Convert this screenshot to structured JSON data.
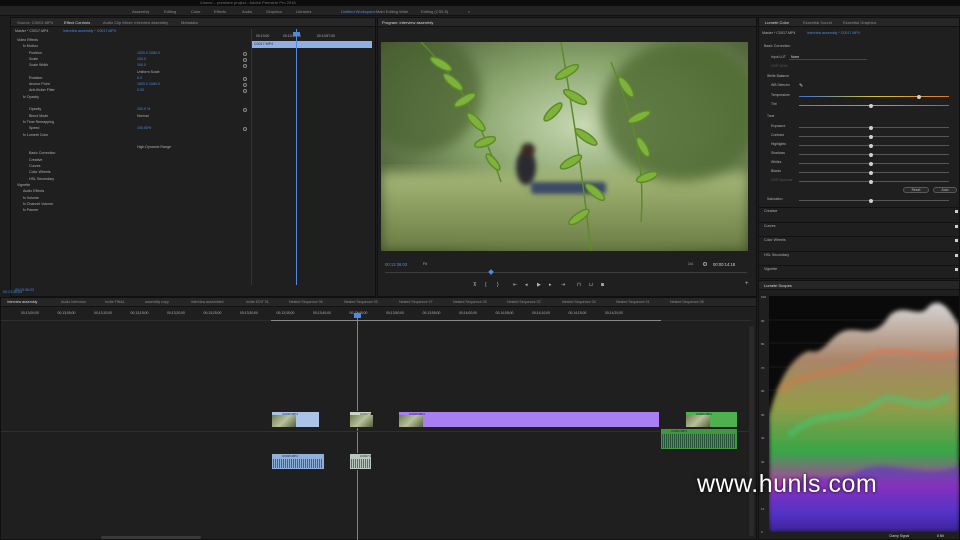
{
  "titlebar": {
    "text": "/Users/... premiere project - Adobe Premiere Pro 2018"
  },
  "workspaces": [
    {
      "label": "Assembly",
      "active": false
    },
    {
      "label": "Editing",
      "active": false
    },
    {
      "label": "Color",
      "active": false
    },
    {
      "label": "Effects",
      "active": false
    },
    {
      "label": "Audio",
      "active": false
    },
    {
      "label": "Graphics",
      "active": false
    },
    {
      "label": "Libraries",
      "active": false
    },
    {
      "label": "Untitled Workspace",
      "active": true
    },
    {
      "label": "Main Editing Wide",
      "active": false
    },
    {
      "label": "Editing (CS5.5)",
      "active": false
    }
  ],
  "effect_controls": {
    "tabs": [
      "Source: C0001.MP4",
      "Effect Controls",
      "Audio Clip Mixer: interview assembly",
      "Metadata"
    ],
    "selected_tab": 1,
    "header_clip": "Master * C0017.MP4",
    "header_seq": "interview assembly * C0017.MP4",
    "rows": [
      {
        "label": "Video Effects",
        "value": ""
      },
      {
        "label": "fx  Motion",
        "value": ""
      },
      {
        "label": "Position",
        "value": "1920.0   1080.0"
      },
      {
        "label": "Scale",
        "value": "100.0"
      },
      {
        "label": "Scale Width",
        "value": "100.0"
      },
      {
        "label": "",
        "value": "Uniform Scale"
      },
      {
        "label": "Rotation",
        "value": "0.0"
      },
      {
        "label": "Anchor Point",
        "value": "1920.0   1080.0"
      },
      {
        "label": "Anti-flicker Filter",
        "value": "0.00"
      },
      {
        "label": "fx  Opacity",
        "value": ""
      },
      {
        "label": "",
        "value": ""
      },
      {
        "label": "Opacity",
        "value": "100.0 %"
      },
      {
        "label": "Blend Mode",
        "value": "Normal"
      },
      {
        "label": "fx  Time Remapping",
        "value": ""
      },
      {
        "label": "Speed",
        "value": "100.00%"
      },
      {
        "label": "fx  Lumetri Color",
        "value": ""
      },
      {
        "label": "",
        "value": ""
      },
      {
        "label": "",
        "value": "High Dynamic Range"
      },
      {
        "label": "Basic Correction",
        "value": ""
      },
      {
        "label": "Creative",
        "value": ""
      },
      {
        "label": "Curves",
        "value": ""
      },
      {
        "label": "Color Wheels",
        "value": ""
      },
      {
        "label": "HSL Secondary",
        "value": ""
      },
      {
        "label": "Vignette",
        "value": ""
      },
      {
        "label": "Audio Effects",
        "value": ""
      },
      {
        "label": "fx  Volume",
        "value": ""
      },
      {
        "label": "fx  Channel Volume",
        "value": ""
      },
      {
        "label": "fx  Panner",
        "value": ""
      }
    ],
    "mini_ruler": [
      "00:13:00",
      "00:13:30:00",
      "00:13:57:00"
    ],
    "mini_clip": "C0017.MP4",
    "bottom_timecode": "00:13:36:03"
  },
  "program": {
    "tab": "Program: interview assembly",
    "timecode": "00:13:36:03",
    "fit": "Fit",
    "quality": "1/4",
    "duration": "00:00:14:18"
  },
  "timeline": {
    "tabs": [
      "interview assembly",
      "Audio Interview",
      "Invite FINAL",
      "assembly copy",
      "interview assembled",
      "Invite EDIT 01",
      "Nested Sequence 06",
      "Nested Sequence 05",
      "Nested Sequence 07",
      "Nested Sequence 03",
      "Nested Sequence 02",
      "Nested Sequence 04",
      "Nested Sequence 01",
      "Nested Sequence 08"
    ],
    "timecode": "00:13:36:03",
    "ruler": [
      "00;13;00;00",
      "00;13;05;00",
      "00;13;10;00",
      "00;13;15;00",
      "00;13;20;00",
      "00;13;25;00",
      "00;13;30;00",
      "00;13;35;00",
      "00;13;40;00",
      "00;13;45;00",
      "00;13;50;00",
      "00;13;55;00",
      "00;14;00;00",
      "00;14;05;00",
      "00;14;10;00",
      "00;14;15;00",
      "00;14;20;00"
    ],
    "clips": [
      {
        "label": "C0015.MP4",
        "track": "v1",
        "color": "#a9c4e6"
      },
      {
        "label": "C0017.MP4",
        "track": "v1",
        "color": "#c9d6c0"
      },
      {
        "label": "C0019.MP4",
        "track": "v1",
        "color": "#a77ff0"
      },
      {
        "label": "C0021.MP4",
        "track": "v1",
        "color": "#4fb04f"
      },
      {
        "label": "C0015.MP4",
        "track": "a1",
        "color": "#8fb0d9"
      },
      {
        "label": "C0017.MP4",
        "track": "a1",
        "color": "#b9c7bf"
      },
      {
        "label": "C0021.MP4",
        "track": "a1",
        "color": "#3f9a3f"
      }
    ]
  },
  "lumetri": {
    "tabs": [
      "Lumetri Color",
      "Essential Sound",
      "Essential Graphics"
    ],
    "header_clip": "Master * C0017.MP4",
    "header_seq": "interview assembly * C0017.MP4",
    "basic": "Basic Correction",
    "input_lut_label": "Input LUT",
    "input_lut_value": "None",
    "hdr_white": "HDR White",
    "white_balance": "White Balance",
    "wb_selector": "WB Selector",
    "sliders_wb": [
      {
        "label": "Temperature",
        "pos": 0.8
      },
      {
        "label": "Tint",
        "pos": 0.48
      }
    ],
    "tone": "Tone",
    "sliders_tone": [
      {
        "label": "Exposure",
        "pos": 0.48
      },
      {
        "label": "Contrast",
        "pos": 0.48
      },
      {
        "label": "Highlights",
        "pos": 0.48
      },
      {
        "label": "Shadows",
        "pos": 0.48
      },
      {
        "label": "Whites",
        "pos": 0.48
      },
      {
        "label": "Blacks",
        "pos": 0.48
      },
      {
        "label": "HDR Specular",
        "pos": 0.48
      }
    ],
    "reset": "Reset",
    "auto": "Auto",
    "saturation": "Saturation",
    "sections": [
      "Creative",
      "Curves",
      "Color Wheels",
      "HSL Secondary",
      "Vignette"
    ]
  },
  "scopes": {
    "tab": "Lumetri Scopes",
    "axis": [
      "100",
      "90",
      "80",
      "70",
      "60",
      "50",
      "40",
      "30",
      "20",
      "10",
      "0"
    ],
    "footer_label": "Clamp Signal",
    "footer_bits": "8 Bit"
  },
  "watermark": "www.hunls.com"
}
